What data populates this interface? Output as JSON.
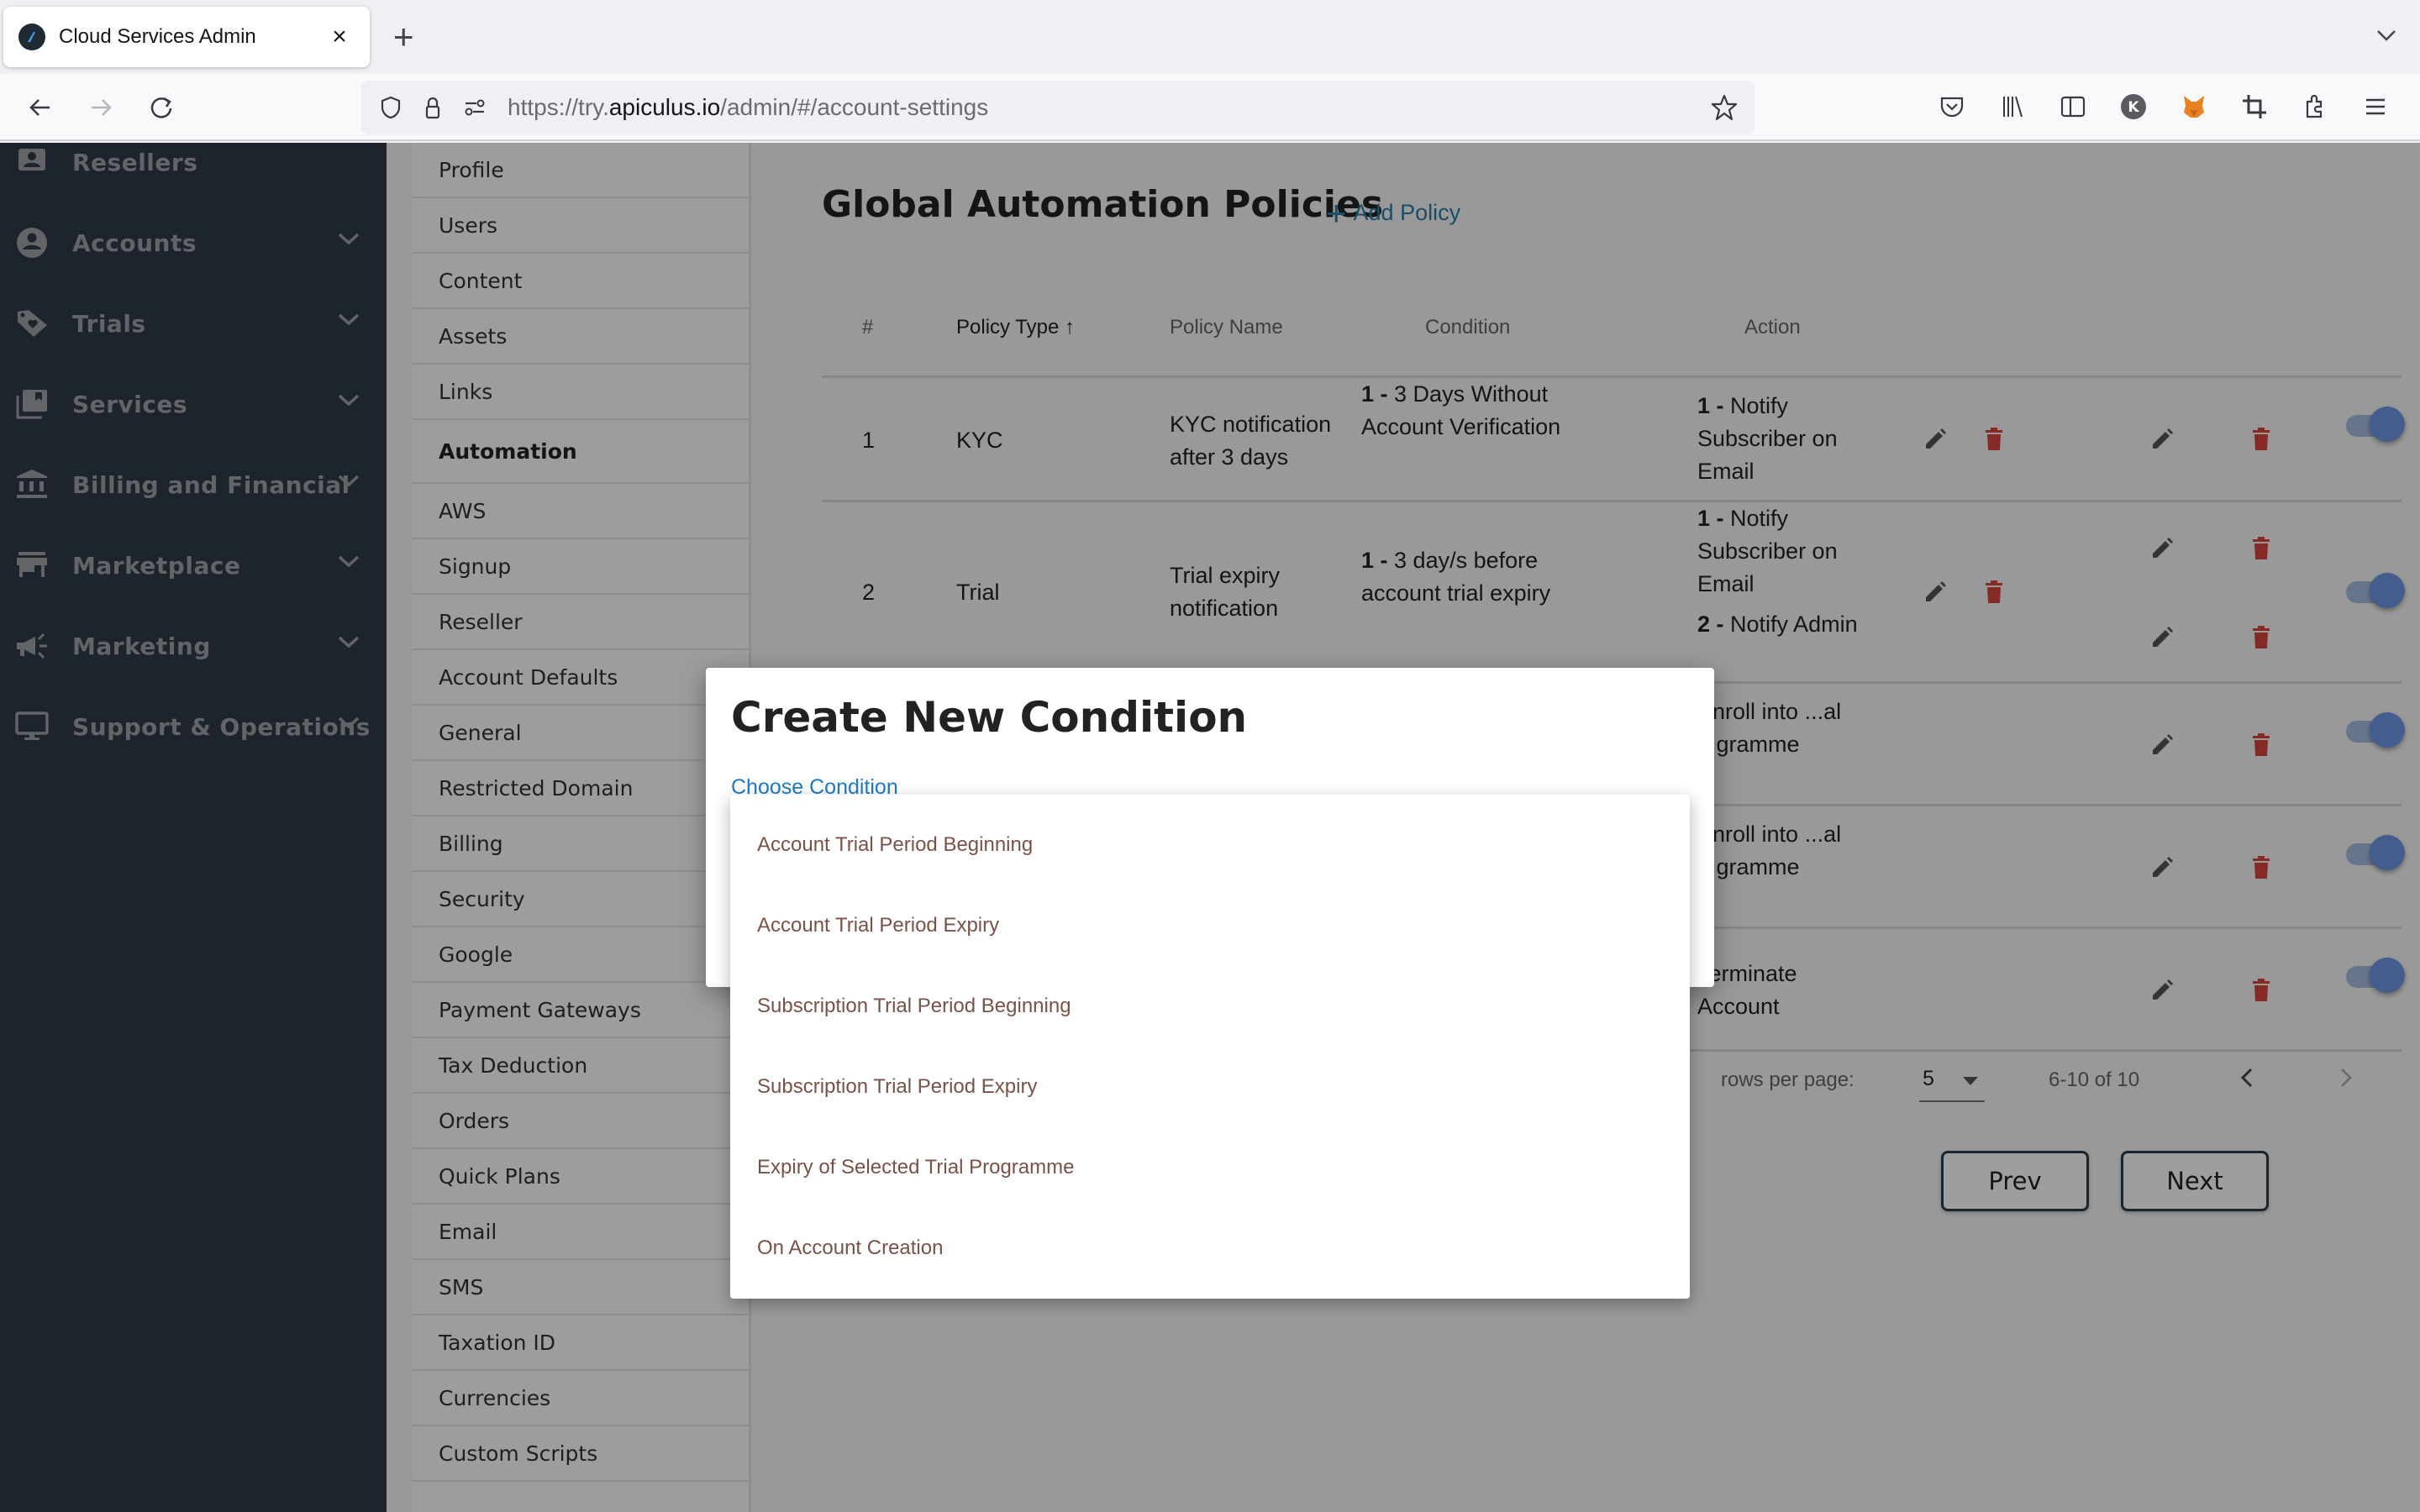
{
  "browser": {
    "tab_title": "Cloud Services Admin",
    "url_prefix": "https://try.",
    "url_host": "apiculus.io",
    "url_path": "/admin/#/account-settings"
  },
  "sidebar": {
    "items": [
      {
        "label": "Resellers",
        "icon": "person-badge-icon",
        "expandable": false
      },
      {
        "label": "Accounts",
        "icon": "account-circle-icon",
        "expandable": true
      },
      {
        "label": "Trials",
        "icon": "tag-heart-icon",
        "expandable": true
      },
      {
        "label": "Services",
        "icon": "collections-bookmark-icon",
        "expandable": true
      },
      {
        "label": "Billing and Financial",
        "icon": "bank-icon",
        "expandable": true
      },
      {
        "label": "Marketplace",
        "icon": "storefront-icon",
        "expandable": true
      },
      {
        "label": "Marketing",
        "icon": "megaphone-icon",
        "expandable": true
      },
      {
        "label": "Support & Operations",
        "icon": "monitor-icon",
        "expandable": true
      }
    ]
  },
  "settings_nav": {
    "active": "Automation",
    "items": [
      "Profile",
      "Users",
      "Content",
      "Assets",
      "Links",
      "Automation",
      "AWS",
      "Signup",
      "Reseller",
      "Account Defaults",
      "General",
      "Restricted Domain",
      "Billing",
      "Security",
      "Google",
      "Payment Gateways",
      "Tax Deduction",
      "Orders",
      "Quick Plans",
      "Email",
      "SMS",
      "Taxation ID",
      "Currencies",
      "Custom Scripts"
    ]
  },
  "policies": {
    "title": "Global Automation Policies",
    "add_label": "Add Policy",
    "columns": {
      "num": "#",
      "type": "Policy Type",
      "name": "Policy Name",
      "condition": "Condition",
      "action": "Action"
    },
    "sort_column": "Policy Type",
    "sort_direction": "ascending",
    "rows": [
      {
        "num": "1",
        "type": "KYC",
        "name": "KYC notification after 3 days",
        "conditions": [
          {
            "idx": "1 -",
            "text": "3 Days Without Account Verification"
          }
        ],
        "actions": [
          {
            "idx": "1 -",
            "text": "Notify Subscriber on Email"
          }
        ],
        "enabled": true
      },
      {
        "num": "2",
        "type": "Trial",
        "name": "Trial expiry notification",
        "conditions": [
          {
            "idx": "1 -",
            "text": "3 day/s before account trial expiry"
          }
        ],
        "actions": [
          {
            "idx": "1 -",
            "text": "Notify Subscriber on Email"
          },
          {
            "idx": "2 -",
            "text": "Notify Admin"
          }
        ],
        "enabled": true
      },
      {
        "actions": [
          {
            "text_visible": "Enroll into ...al ...gramme"
          }
        ],
        "enabled": true
      },
      {
        "actions": [
          {
            "text_visible": "Enroll into ...al ...gramme"
          }
        ],
        "enabled": true
      },
      {
        "actions": [
          {
            "text_visible": "Terminate Account"
          }
        ],
        "enabled": true
      }
    ],
    "pagination": {
      "rows_per_page_label": "rows per page:",
      "rows_per_page": "5",
      "range": "6-10 of 10",
      "prev_label": "Prev",
      "next_label": "Next"
    }
  },
  "modal": {
    "title": "Create New Condition",
    "field_label": "Choose Condition",
    "options": [
      "Account Trial Period Beginning",
      "Account Trial Period Expiry",
      "Subscription Trial Period Beginning",
      "Subscription Trial Period Expiry",
      "Expiry of Selected Trial Programme",
      "On Account Creation"
    ]
  },
  "colors": {
    "sidebar_bg": "#2f3b48",
    "link_blue": "#2b7da5",
    "label_blue": "#1f7ac6",
    "delete_red": "#d9453c",
    "toggle_blue": "#6d97e6",
    "option_text": "#7b5248"
  }
}
